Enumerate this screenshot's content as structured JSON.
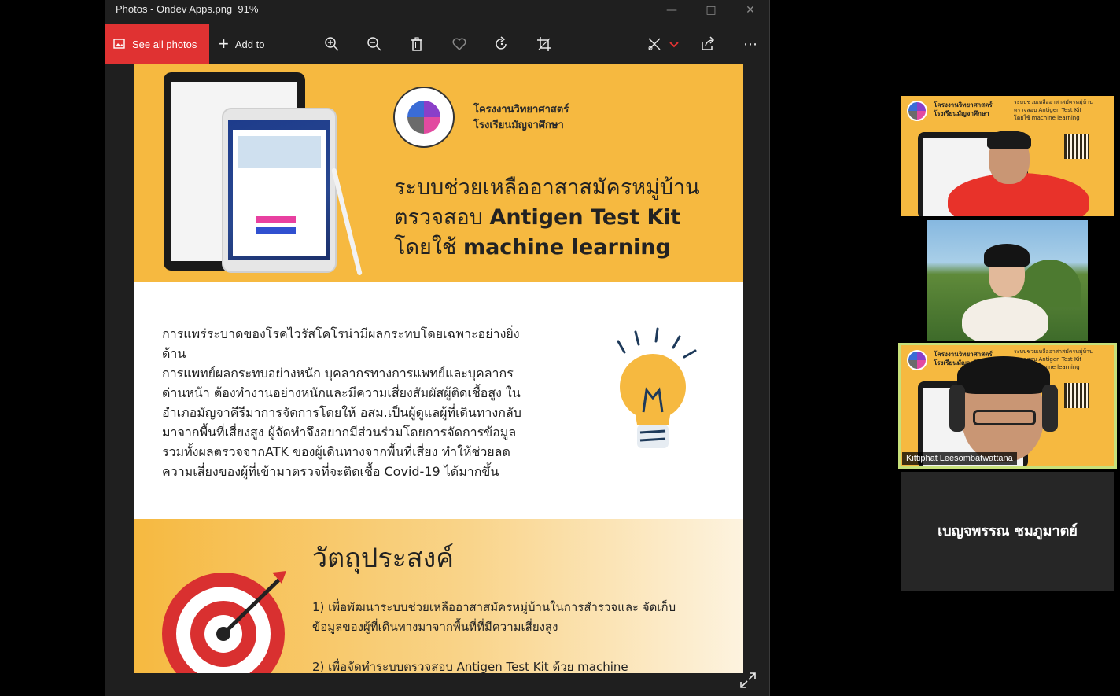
{
  "window": {
    "title": "Photos - Ondev Apps.png",
    "zoom": "91%"
  },
  "toolbar": {
    "see_all_label": "See all photos",
    "add_to_label": "Add to"
  },
  "photo": {
    "school_line1": "โครงงานวิทยาศาสตร์",
    "school_line2": "โรงเรียนมัญจาศึกษา",
    "title_line1": "ระบบช่วยเหลืออาสาสมัครหมู่บ้าน",
    "title_line2_a": "ตรวจสอบ ",
    "title_line2_b": "Antigen Test Kit",
    "title_line3_a": "โดยใช้ ",
    "title_line3_b": "machine learning",
    "body": [
      "การแพร่ระบาดของโรคไวรัสโคโรน่ามีผลกระทบโดยเฉพาะอย่างยิ่งด้าน",
      "การแพทย์ผลกระทบอย่างหนัก บุคลากรทางการแพทย์และบุคลากร",
      "ด่านหน้า ต้องทำงานอย่างหนักและมีความเสี่ยงสัมผัสผู้ติดเชื้อสูง ใน",
      "อำเภอมัญจาคีรีมาการจัดการโดยให้ อสม.เป็นผู้ดูแลผู้ที่เดินทางกลับ",
      "มาจากพื้นที่เสี่ยงสูง ผู้จัดทำจึงอยากมีส่วนร่วมโดยการจัดการข้อมูล",
      "รวมทั้งผลตรวจจากATK ของผู้เดินทางจากพื้นที่เสี่ยง ทำให้ช่วยลด",
      "ความเสี่ยงของผู้ที่เข้ามาตรวจที่จะติดเชื้อ Covid-19 ได้มากขึ้น"
    ],
    "objective_title": "วัตถุประสงค์",
    "objective_1_line1": "1) เพื่อพัฒนาระบบช่วยเหลืออาสาสมัครหมู่บ้านในการสำรวจและ จัดเก็บ",
    "objective_1_line2": "ข้อมูลของผู้ที่เดินทางมาจากพื้นที่ที่มีความเสี่ยงสูง",
    "objective_2": "2) เพื่อจัดทำระบบตรวจสอบ Antigen Test Kit ด้วย machine"
  },
  "participants": {
    "slide_left_1": "โครงงานวิทยาศาสตร์",
    "slide_left_2": "โรงเรียนมัญจาศึกษา",
    "slide_right_1": "ระบบช่วยเหลืออาสาสมัครหมู่บ้าน",
    "slide_right_2": "ตรวจสอบ Antigen Test Kit",
    "slide_right_3": "โดยใช้ machine learning",
    "speaker_name": "Kittiphat Leesombatwattana",
    "audio_only_name": "เบญจพรรณ ชมภูมาตย์"
  },
  "colors": {
    "accent_red": "#e03232",
    "poster_orange": "#f6b940",
    "active_speaker_border": "#c7e07a"
  }
}
